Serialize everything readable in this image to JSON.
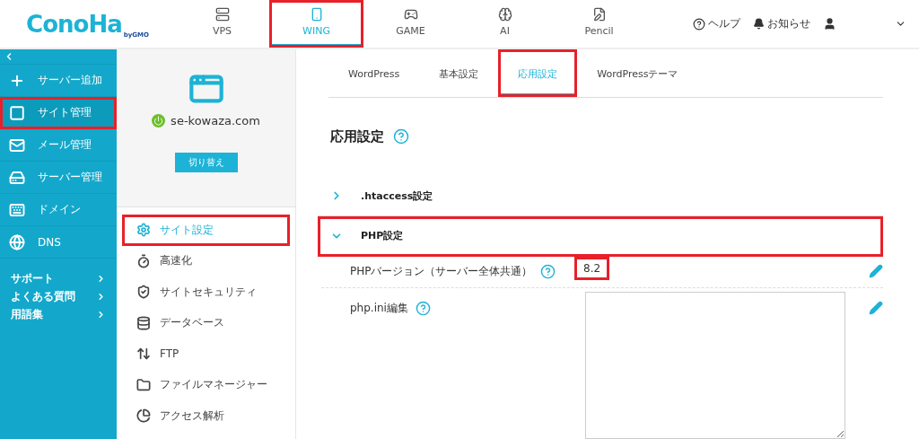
{
  "logo": {
    "name": "ConoHa",
    "sub": "byGMO"
  },
  "nav": [
    {
      "label": "VPS",
      "selected": false,
      "highlighted": false
    },
    {
      "label": "WING",
      "selected": true,
      "highlighted": true
    },
    {
      "label": "GAME",
      "selected": false,
      "highlighted": false
    },
    {
      "label": "AI",
      "selected": false,
      "highlighted": false
    },
    {
      "label": "Pencil",
      "selected": false,
      "highlighted": false
    }
  ],
  "header_links": [
    {
      "label": "ヘルプ"
    },
    {
      "label": "お知らせ"
    }
  ],
  "sidebar": {
    "items": [
      {
        "label": "サーバー追加",
        "selected": false,
        "highlighted": false
      },
      {
        "label": "サイト管理",
        "selected": true,
        "highlighted": true
      },
      {
        "label": "メール管理",
        "selected": false,
        "highlighted": false
      },
      {
        "label": "サーバー管理",
        "selected": false,
        "highlighted": false
      },
      {
        "label": "ドメイン",
        "selected": false,
        "highlighted": false
      },
      {
        "label": "DNS",
        "selected": false,
        "highlighted": false
      }
    ],
    "links": [
      "サポート",
      "よくある質問",
      "用語集"
    ]
  },
  "site": {
    "domain": "se-kowaza.com",
    "online": true,
    "switch_button": "切り替え"
  },
  "site_menu": [
    {
      "label": "サイト設定",
      "selected": true,
      "highlighted": true
    },
    {
      "label": "高速化",
      "selected": false,
      "highlighted": false
    },
    {
      "label": "サイトセキュリティ",
      "selected": false,
      "highlighted": false
    },
    {
      "label": "データベース",
      "selected": false,
      "highlighted": false
    },
    {
      "label": "FTP",
      "selected": false,
      "highlighted": false
    },
    {
      "label": "ファイルマネージャー",
      "selected": false,
      "highlighted": false
    },
    {
      "label": "アクセス解析",
      "selected": false,
      "highlighted": false
    }
  ],
  "tabs": [
    {
      "label": "WordPress",
      "selected": false,
      "highlighted": false
    },
    {
      "label": "基本設定",
      "selected": false,
      "highlighted": false
    },
    {
      "label": "応用設定",
      "selected": true,
      "highlighted": true
    },
    {
      "label": "WordPressテーマ",
      "selected": false,
      "highlighted": false
    }
  ],
  "section_title": "応用設定",
  "sections": [
    {
      "label": ".htaccess設定",
      "expanded": false,
      "highlighted": false
    },
    {
      "label": "PHP設定",
      "expanded": true,
      "highlighted": true
    }
  ],
  "php": {
    "version_label": "PHPバージョン（サーバー全体共通）",
    "version": "8.2",
    "version_highlighted": true,
    "ini_label": "php.ini編集"
  }
}
